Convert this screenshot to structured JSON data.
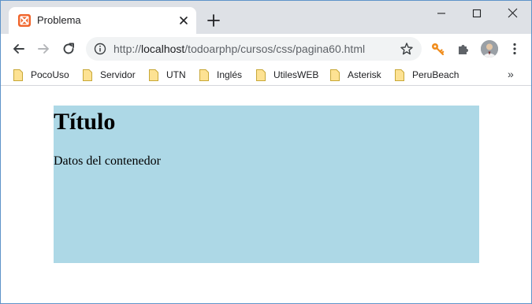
{
  "tab": {
    "title": "Problema",
    "favicon": "xampp-icon"
  },
  "omnibox": {
    "url_prefix": "http://",
    "url_host": "localhost",
    "url_path": "/todoarphp/cursos/css/pagina60.html"
  },
  "bookmarks": [
    {
      "label": "PocoUso"
    },
    {
      "label": "Servidor"
    },
    {
      "label": "UTN"
    },
    {
      "label": "Inglés"
    },
    {
      "label": "UtilesWEB"
    },
    {
      "label": "Asterisk"
    },
    {
      "label": "PeruBeach"
    }
  ],
  "bookmarks_more": "»",
  "page": {
    "heading": "Título",
    "paragraph": "Datos del contenedor",
    "container_color": "#add8e6"
  },
  "colors": {
    "titlebar": "#dee1e6",
    "favicon": "#f0642a",
    "key_extension": "#f08c1c"
  }
}
